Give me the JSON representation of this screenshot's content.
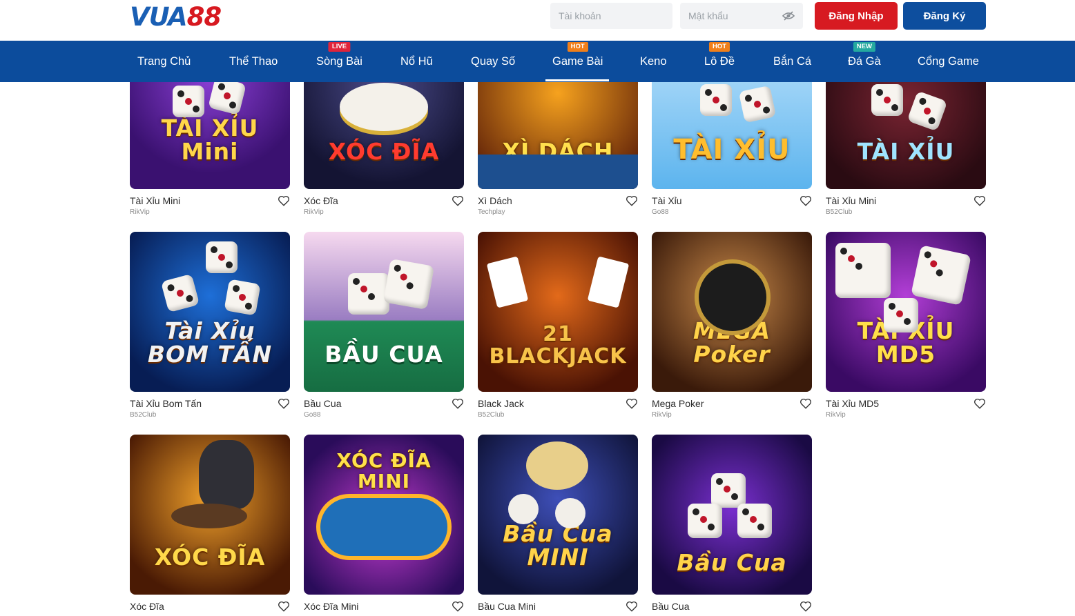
{
  "header": {
    "logo_part1": "VUA",
    "logo_part2": "88",
    "username_placeholder": "Tài khoản",
    "password_placeholder": "Mật khẩu",
    "login_label": "Đăng Nhập",
    "register_label": "Đăng Ký"
  },
  "nav": {
    "items": [
      {
        "label": "Trang Chủ",
        "badge": ""
      },
      {
        "label": "Thể Thao",
        "badge": ""
      },
      {
        "label": "Sòng Bài",
        "badge": "LIVE"
      },
      {
        "label": "Nổ Hũ",
        "badge": ""
      },
      {
        "label": "Quay Số",
        "badge": ""
      },
      {
        "label": "Game Bài",
        "badge": "HOT"
      },
      {
        "label": "Keno",
        "badge": ""
      },
      {
        "label": "Lô Đề",
        "badge": "HOT"
      },
      {
        "label": "Bắn Cá",
        "badge": ""
      },
      {
        "label": "Đá Gà",
        "badge": "NEW"
      },
      {
        "label": "Cổng Game",
        "badge": ""
      }
    ],
    "active": "Game Bài"
  },
  "games": [
    {
      "title": "Tài Xỉu Mini",
      "provider": "RikVip",
      "art": "TÀI XỈU Mini"
    },
    {
      "title": "Xóc Đĩa",
      "provider": "RikVip",
      "art": "XÓC ĐĨA"
    },
    {
      "title": "Xì Dách",
      "provider": "Techplay",
      "art": "XÌ DÁCH"
    },
    {
      "title": "Tài Xỉu",
      "provider": "Go88",
      "art": "TÀI XỈU"
    },
    {
      "title": "Tài Xỉu Mini",
      "provider": "B52Club",
      "art": "TÀI XỈU"
    },
    {
      "title": "Tài Xỉu Bom Tấn",
      "provider": "B52Club",
      "art": "Tài Xỉu BOM TẤN"
    },
    {
      "title": "Bầu Cua",
      "provider": "Go88",
      "art": "BẦU CUA"
    },
    {
      "title": "Black Jack",
      "provider": "B52Club",
      "art": "21 BLACKJACK"
    },
    {
      "title": "Mega Poker",
      "provider": "RikVip",
      "art": "MEGA Poker"
    },
    {
      "title": "Tài Xỉu MD5",
      "provider": "RikVip",
      "art": "TÀI XỈU MD5"
    },
    {
      "title": "Xóc Đĩa",
      "provider": "",
      "art": "XÓC ĐĨA"
    },
    {
      "title": "Xóc Đĩa Mini",
      "provider": "",
      "art": "XÓC ĐĨA MINI"
    },
    {
      "title": "Bầu Cua Mini",
      "provider": "",
      "art": "Bầu Cua MINI"
    },
    {
      "title": "Bầu Cua",
      "provider": "",
      "art": "Bầu Cua"
    }
  ],
  "colors": {
    "brand_blue": "#0c4c9c",
    "login_red": "#d71a21",
    "register_blue": "#0d4e9e"
  }
}
